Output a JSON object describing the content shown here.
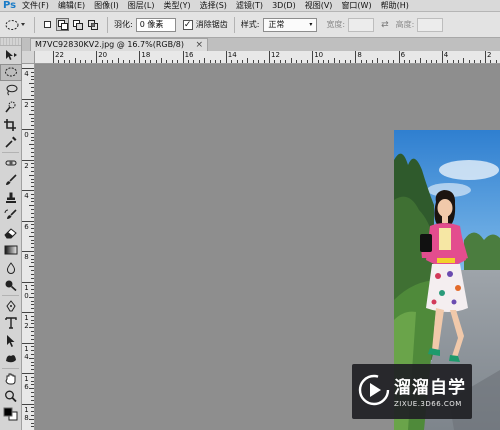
{
  "app": {
    "logo": "Ps"
  },
  "menu": [
    "文件(F)",
    "编辑(E)",
    "图像(I)",
    "图层(L)",
    "类型(Y)",
    "选择(S)",
    "滤镜(T)",
    "3D(D)",
    "视图(V)",
    "窗口(W)",
    "帮助(H)"
  ],
  "options": {
    "feather_label": "羽化:",
    "feather_value": "0 像素",
    "antialias_label": "消除锯齿",
    "antialias_checked": true,
    "style_label": "样式:",
    "style_value": "正常",
    "width_label": "宽度:",
    "height_label": "高度:"
  },
  "document": {
    "tab_title": "M7VC92830KV2.jpg @ 16.7%(RGB/8)",
    "close_glyph": "×"
  },
  "ruler": {
    "top_labels": [
      "22",
      "20",
      "18",
      "16",
      "14",
      "12",
      "10",
      "8",
      "6",
      "4",
      "2"
    ],
    "left_labels": [
      "4",
      "2",
      "0",
      "2",
      "4",
      "6",
      "8",
      "1 0",
      "1 2",
      "1 4",
      "1 6",
      "1 8"
    ]
  },
  "watermark": {
    "title": "溜溜自学",
    "url": "ZIXUE.3D66.COM"
  },
  "colors": {
    "ps_blue": "#1b7cc8",
    "canvas_gray": "#8e8e8e",
    "panel_gray": "#d4d4d4",
    "watermark_bg": "#202024"
  },
  "tools": [
    "move-tool",
    "marquee-tool",
    "lasso-tool",
    "quick-selection-tool",
    "crop-tool",
    "eyedropper-tool",
    "spot-healing-tool",
    "brush-tool",
    "clone-stamp-tool",
    "history-brush-tool",
    "eraser-tool",
    "gradient-tool",
    "blur-tool",
    "dodge-tool",
    "pen-tool",
    "type-tool",
    "path-selection-tool",
    "shape-tool",
    "hand-tool",
    "zoom-tool",
    "color-swatches"
  ]
}
